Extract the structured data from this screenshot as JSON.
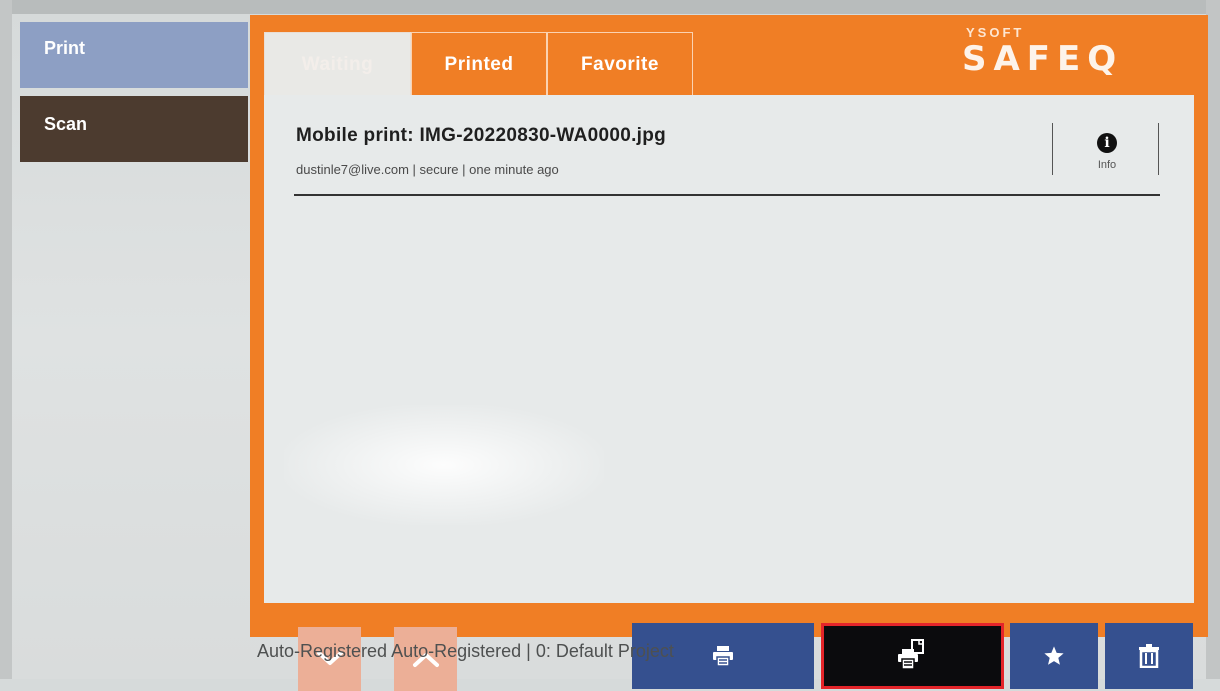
{
  "nav": {
    "print_label": "Print",
    "scan_label": "Scan"
  },
  "tabs": [
    {
      "label": "Waiting",
      "active": true
    },
    {
      "label": "Printed",
      "active": false
    },
    {
      "label": "Favorite",
      "active": false
    }
  ],
  "brand": {
    "top": "YSOFT",
    "name": "SAFEQ"
  },
  "job": {
    "title": "Mobile print: IMG-20220830-WA0000.jpg",
    "meta": "dustinle7@live.com | secure | one minute ago",
    "info_label": "Info"
  },
  "toolbar": {
    "scroll_down_icon": "chevron-down-icon",
    "scroll_up_icon": "chevron-up-icon",
    "print_icon": "printer-icon",
    "print_and_keep_icon": "printer-copy-icon",
    "favorite_icon": "star-icon",
    "delete_icon": "trash-icon",
    "highlighted": "print_and_keep"
  },
  "footer": {
    "text": "Auto-Registered Auto-Registered   | 0: Default Project"
  },
  "colors": {
    "frame": "#f07e25",
    "action_blue": "#35508f",
    "highlight_border": "#e4252a",
    "nav_print": "#8d9fc4",
    "nav_scan": "#4c3b2f"
  }
}
